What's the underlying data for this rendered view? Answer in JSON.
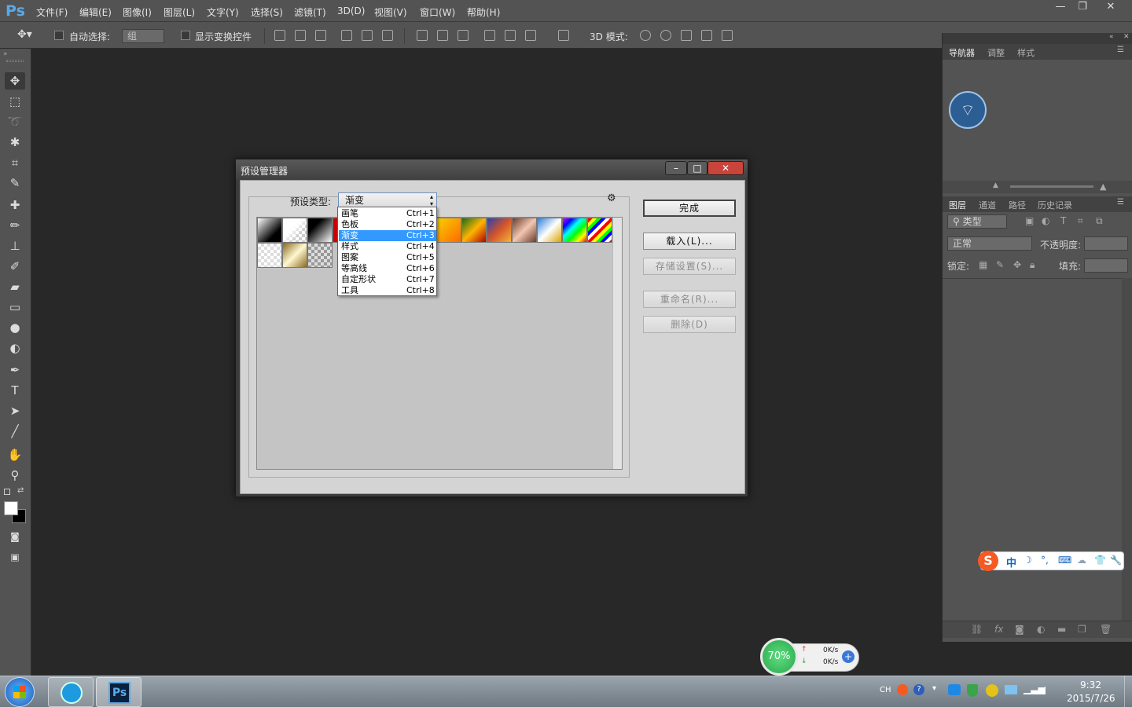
{
  "app": {
    "logo": "Ps",
    "menus": [
      "文件(F)",
      "编辑(E)",
      "图像(I)",
      "图层(L)",
      "文字(Y)",
      "选择(S)",
      "滤镜(T)",
      "3D(D)",
      "视图(V)",
      "窗口(W)",
      "帮助(H)"
    ],
    "window_controls": {
      "minimize": "—",
      "restore": "❐",
      "close": "✕"
    }
  },
  "options_bar": {
    "auto_select_label": "自动选择:",
    "auto_select_value": "组",
    "show_transform_label": "显示变换控件",
    "mode_3d_label": "3D 模式:"
  },
  "right_panel": {
    "top_tabs": [
      "导航器",
      "调整",
      "样式"
    ],
    "layer_tabs": [
      "图层",
      "通道",
      "路径",
      "历史记录"
    ],
    "filter_label": "类型",
    "blend_mode": "正常",
    "opacity_label": "不透明度:",
    "lock_label": "锁定:",
    "fill_label": "填充:"
  },
  "dialog": {
    "title": "预设管理器",
    "preset_type_label": "预设类型:",
    "preset_type_value": "渐变",
    "gear_icon": "⚙",
    "buttons": {
      "done": "完成",
      "load": "载入(L)...",
      "save": "存储设置(S)...",
      "rename": "重命名(R)...",
      "delete": "删除(D)"
    }
  },
  "dropdown": {
    "items": [
      {
        "label": "画笔",
        "shortcut": "Ctrl+1"
      },
      {
        "label": "色板",
        "shortcut": "Ctrl+2"
      },
      {
        "label": "渐变",
        "shortcut": "Ctrl+3"
      },
      {
        "label": "样式",
        "shortcut": "Ctrl+4"
      },
      {
        "label": "图案",
        "shortcut": "Ctrl+5"
      },
      {
        "label": "等高线",
        "shortcut": "Ctrl+6"
      },
      {
        "label": "自定形状",
        "shortcut": "Ctrl+7"
      },
      {
        "label": "工具",
        "shortcut": "Ctrl+8"
      }
    ],
    "selected_index": 2
  },
  "net_widget": {
    "percent": "70%",
    "up_speed": "0K/s",
    "down_speed": "0K/s"
  },
  "ime": {
    "chars": [
      "中",
      "☽",
      "°,",
      "⌨",
      "☁",
      "👕",
      "🔧"
    ]
  },
  "taskbar": {
    "lang": "CH",
    "time": "9:32",
    "date": "2015/7/26"
  },
  "colors": {
    "workspace": "#282828",
    "panel": "#535353",
    "dialog_body": "#d4d4d4",
    "selection": "#3399ff"
  }
}
